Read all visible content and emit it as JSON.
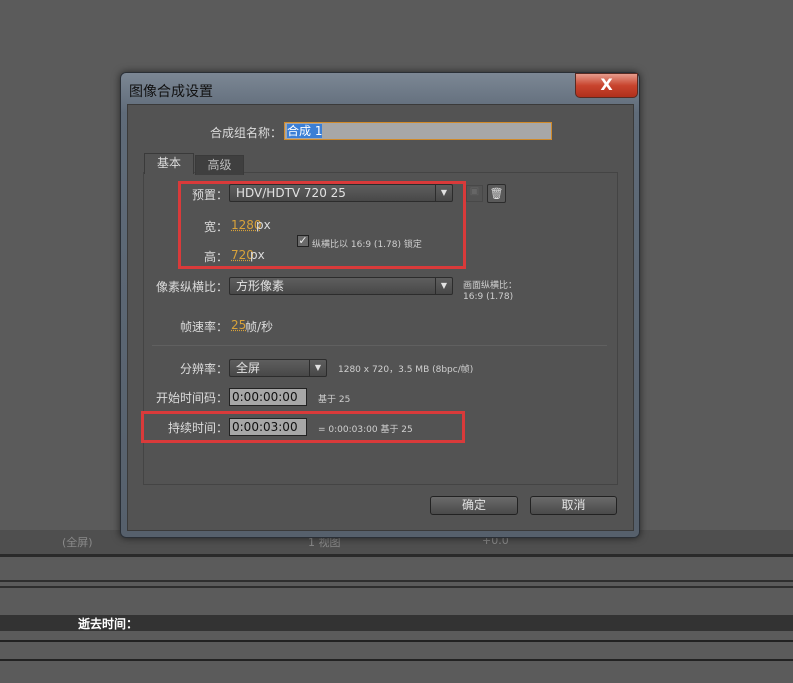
{
  "dialog": {
    "title": "图像合成设置",
    "close_label": "X",
    "comp_name_label": "合成组名称：",
    "comp_name_value": "合成 1",
    "tabs": [
      {
        "label": "基本"
      },
      {
        "label": "高级"
      }
    ],
    "preset_label": "预置：",
    "preset_value": "HDV/HDTV 720 25",
    "width_label": "宽：",
    "width_value": "1280",
    "width_unit": "px",
    "height_label": "高：",
    "height_value": "720",
    "height_unit": "px",
    "lock_aspect_label": "纵横比以 16:9 (1.78) 锁定",
    "lock_aspect_checked": true,
    "pixel_aspect_label": "像素纵横比：",
    "pixel_aspect_value": "方形像素",
    "frame_aspect_label": "画面纵横比：",
    "frame_aspect_value": "16:9 (1.78)",
    "frame_rate_label": "帧速率：",
    "frame_rate_value": "25",
    "frame_rate_unit": "帧/秒",
    "resolution_label": "分辨率：",
    "resolution_value": "全屏",
    "resolution_info": "1280 x 720，3.5 MB (8bpc/帧)",
    "start_tc_label": "开始时间码：",
    "start_tc_value": "0:00:00:00",
    "start_tc_info": "基于 25",
    "duration_label": "持续时间：",
    "duration_value": "0:00:03:00",
    "duration_info": "= 0:00:03:00  基于 25",
    "ok_label": "确定",
    "cancel_label": "取消"
  },
  "background": {
    "toolbar_zoom": "(全屏)",
    "toolbar_view": "1 视图",
    "toolbar_exposure": "+0.0",
    "elapsed_label": "逝去时间："
  }
}
